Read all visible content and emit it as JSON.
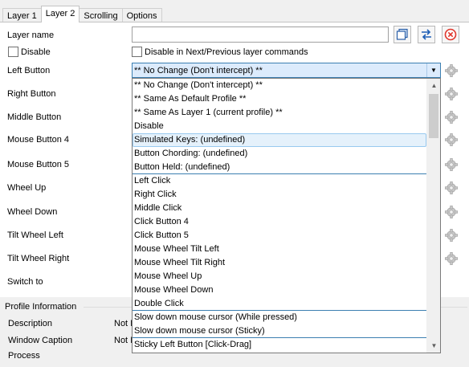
{
  "tabs": [
    "Layer 1",
    "Layer 2",
    "Scrolling",
    "Options"
  ],
  "layer_name_label": "Layer name",
  "layer_name_value": "",
  "disable_label": "Disable",
  "disable_next_prev_label": "Disable in Next/Previous layer commands",
  "buttons": [
    "Left Button",
    "Right Button",
    "Middle Button",
    "Mouse Button 4",
    "Mouse Button 5",
    "Wheel Up",
    "Wheel Down",
    "Tilt Wheel Left",
    "Tilt Wheel Right",
    "Switch to"
  ],
  "combo_value": "** No Change (Don't intercept) **",
  "dropdown_items": [
    "** No Change (Don't intercept) **",
    "** Same As Default Profile **",
    "** Same As Layer 1 (current profile) **",
    "Disable",
    "Simulated Keys: (undefined)",
    "Button Chording: (undefined)",
    "Button Held: (undefined)",
    "Left Click",
    "Right Click",
    "Middle Click",
    "Click Button 4",
    "Click Button 5",
    "Mouse Wheel Tilt Left",
    "Mouse Wheel Tilt Right",
    "Mouse Wheel Up",
    "Mouse Wheel Down",
    "Double Click",
    "Slow down mouse cursor (While pressed)",
    "Slow down mouse cursor (Sticky)",
    "Sticky Left Button [Click-Drag]"
  ],
  "selected_index": 4,
  "profile_section_title": "Profile Information",
  "profile_rows": [
    {
      "label": "Description",
      "value": "Not I"
    },
    {
      "label": "Window Caption",
      "value": "Not I"
    },
    {
      "label": "Process",
      "value": ""
    }
  ],
  "icons": {
    "copy": "copy-icon",
    "swap": "swap-arrows-icon",
    "clear": "clear-circle-x-icon",
    "gear": "gear-icon"
  },
  "colors": {
    "accent": "#3c7fb1",
    "combo_bg": "#dcebfc",
    "selected_bg": "#e5f1fb",
    "clear_red": "#e0362c"
  }
}
